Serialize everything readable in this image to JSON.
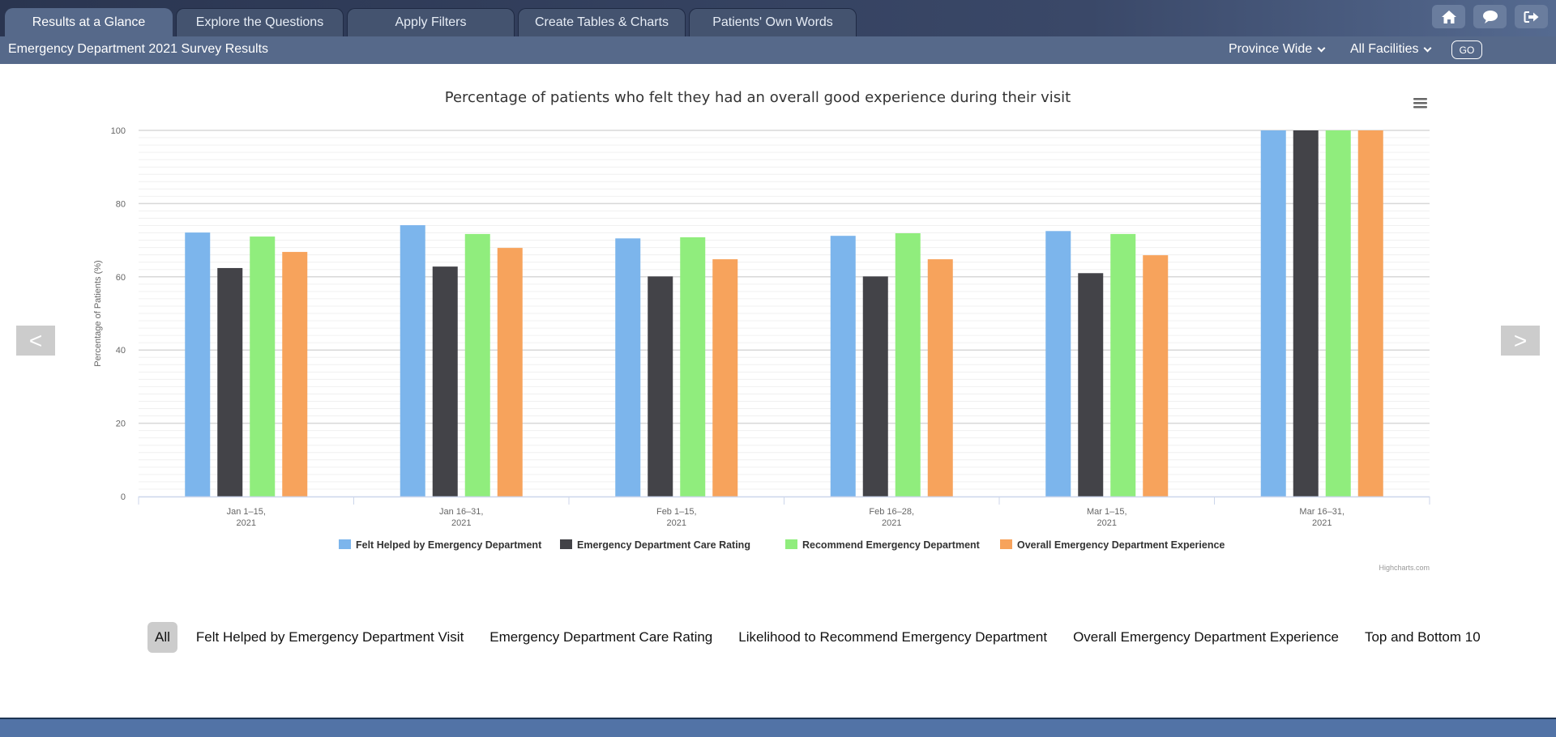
{
  "tabs": [
    {
      "label": "Results at a Glance",
      "active": true
    },
    {
      "label": "Explore the Questions",
      "active": false
    },
    {
      "label": "Apply Filters",
      "active": false
    },
    {
      "label": "Create Tables & Charts",
      "active": false
    },
    {
      "label": "Patients' Own Words",
      "active": false
    }
  ],
  "top_icons": [
    "home-icon",
    "comment-icon",
    "sign-out-icon"
  ],
  "header": {
    "title": "Emergency Department 2021 Survey Results",
    "region_select": "Province Wide",
    "facility_select": "All Facilities",
    "go_label": "GO"
  },
  "nav": {
    "prev_label": "<",
    "next_label": ">"
  },
  "colors": {
    "topbar": "#2a3550",
    "subbar": "#56698a",
    "bottombar": "#5273a6"
  },
  "chart_data": {
    "type": "bar",
    "title": "Percentage of patients who felt they had an overall good experience during their visit",
    "xlabel": "",
    "ylabel": "Percentage of Patients (%)",
    "ylim": [
      0,
      100
    ],
    "yticks": [
      0,
      20,
      40,
      60,
      80,
      100
    ],
    "grid": true,
    "categories": [
      [
        "Jan 1–15,",
        "2021"
      ],
      [
        "Jan 16–31,",
        "2021"
      ],
      [
        "Feb 1–15,",
        "2021"
      ],
      [
        "Feb 16–28,",
        "2021"
      ],
      [
        "Mar 1–15,",
        "2021"
      ],
      [
        "Mar 16–31,",
        "2021"
      ]
    ],
    "series": [
      {
        "name": "Felt Helped by Emergency Department",
        "color": "#7cb5ec",
        "values": [
          72.1,
          74.1,
          70.5,
          71.2,
          72.5,
          100
        ]
      },
      {
        "name": "Emergency Department Care Rating",
        "color": "#434348",
        "values": [
          62.4,
          62.8,
          60.1,
          60.1,
          61.0,
          100
        ]
      },
      {
        "name": "Recommend Emergency Department",
        "color": "#90ed7d",
        "values": [
          71.0,
          71.7,
          70.8,
          71.9,
          71.7,
          100
        ]
      },
      {
        "name": "Overall Emergency Department Experience",
        "color": "#f7a35c",
        "values": [
          66.8,
          67.9,
          64.8,
          64.8,
          65.9,
          100
        ]
      }
    ],
    "legend_position": "bottom-center",
    "credits": "Highcharts.com"
  },
  "filters": [
    {
      "label": "All",
      "active": true
    },
    {
      "label": "Felt Helped by Emergency Department Visit",
      "active": false
    },
    {
      "label": "Emergency Department Care Rating",
      "active": false
    },
    {
      "label": "Likelihood to Recommend Emergency Department",
      "active": false
    },
    {
      "label": "Overall Emergency Department Experience",
      "active": false
    },
    {
      "label": "Top and Bottom 10",
      "active": false
    }
  ]
}
